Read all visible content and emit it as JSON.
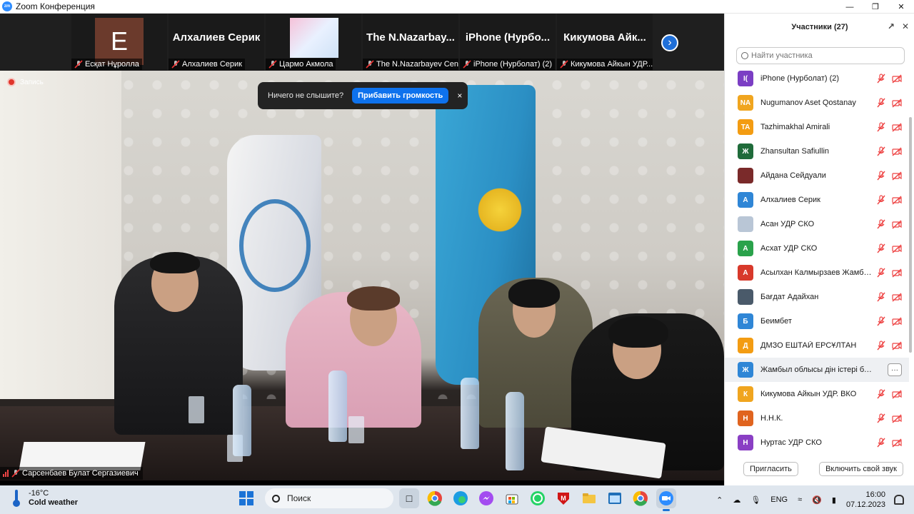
{
  "window": {
    "title": "Zoom Конференция",
    "logo_text": "zm"
  },
  "filmstrip": {
    "tiles": [
      {
        "name": "",
        "caption": "Есқат Нұролла",
        "avatar_letter": "E"
      },
      {
        "name": "Алхалиев Серик",
        "caption": "Алхалиев Серик"
      },
      {
        "name": "",
        "caption": "Цармо Акмола"
      },
      {
        "name": "The  N.Nazarbay...",
        "caption": "The N.Nazarbayev Cen..."
      },
      {
        "name": "iPhone  (Нурбо...",
        "caption": "iPhone (Нурболат) (2)"
      },
      {
        "name": "Кикумова  Айк...",
        "caption": "Кикумова Айкын УДР..."
      }
    ],
    "next_icon": "chevron-right-icon"
  },
  "video": {
    "recording_label": "Запись",
    "notice": {
      "text": "Ничего не слышите?",
      "button": "Прибавить громкость",
      "close": "×"
    },
    "speaker": "Сарсенбаев Булат Сергазиевич"
  },
  "participants": {
    "title": "Участники (27)",
    "search_placeholder": "Найти участника",
    "items": [
      {
        "initials": "I(",
        "name": "iPhone (Нурболат) (2)",
        "color": "#7b3ec4"
      },
      {
        "initials": "NA",
        "name": "Nugumanov Aset Qostanay",
        "color": "#f0a51f"
      },
      {
        "initials": "TA",
        "name": "Tazhimakhal Amirali",
        "color": "#f39c12"
      },
      {
        "initials": "Ж",
        "name": "Zhansultan Safiullin",
        "color": "#1f6b3a"
      },
      {
        "initials": "",
        "name": "Айдана Сейдуали",
        "color": "#7a2a2a"
      },
      {
        "initials": "А",
        "name": "Алхалиев Серик",
        "color": "#2f86d6"
      },
      {
        "initials": "",
        "name": "Асан УДР СКО",
        "color": "#b9c6d6"
      },
      {
        "initials": "А",
        "name": "Асхат УДР СКО",
        "color": "#2aa24b"
      },
      {
        "initials": "А",
        "name": "Асылхан Калмырзаев  Жамбыл ...",
        "color": "#d8392b"
      },
      {
        "initials": "",
        "name": "Бағдат Адайхан",
        "color": "#4a5a6a"
      },
      {
        "initials": "Б",
        "name": "Беимбет",
        "color": "#2f86d6"
      },
      {
        "initials": "Д",
        "name": "ДМЗО ЕШТАЙ ЕРСҰЛТАН",
        "color": "#f39c12"
      },
      {
        "initials": "Ж",
        "name": "Жамбыл облысы дін істері басқар...",
        "color": "#2f86d6"
      },
      {
        "initials": "К",
        "name": "Кикумова Айкын УДР. ВКО",
        "color": "#f0a51f"
      },
      {
        "initials": "Н",
        "name": "Н.Н.К.",
        "color": "#e0641f"
      },
      {
        "initials": "Н",
        "name": "Нуртас УДР СКО",
        "color": "#8a3fc4"
      }
    ],
    "more_label": "···",
    "invite_button": "Пригласить",
    "unmute_button": "Включить свой звук"
  },
  "taskbar": {
    "temperature": "-16°C",
    "weather": "Cold weather",
    "search": "Поиск",
    "language": "ENG",
    "time": "16:00",
    "date": "07.12.2023"
  }
}
